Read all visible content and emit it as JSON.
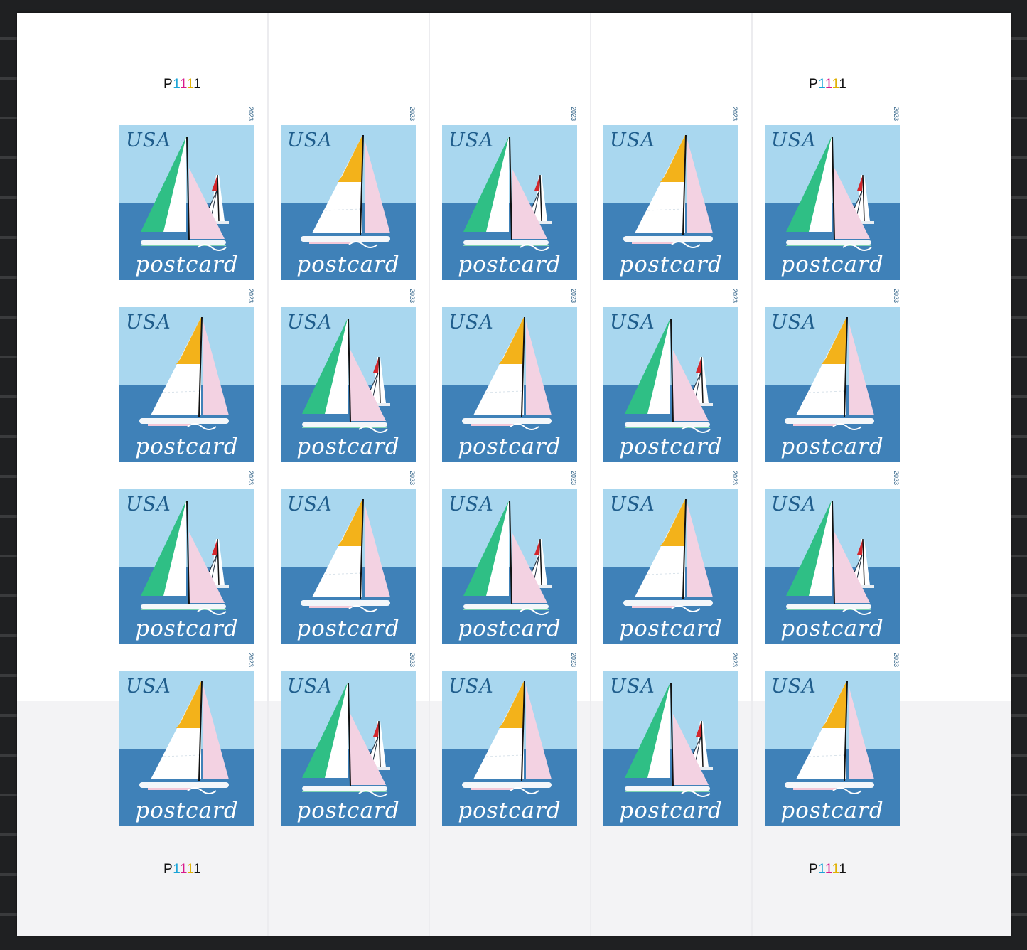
{
  "sheet": {
    "plate_number": "P1111",
    "plate_digit_colors": [
      "#111111",
      "#1aa3d6",
      "#d8198c",
      "#e0b000",
      "#111111"
    ]
  },
  "stamp": {
    "country": "USA",
    "denomination": "postcard",
    "year": "2023",
    "colors": {
      "sky": "#a9d7ef",
      "sea": "#3f81b8",
      "green_sail": "#2fbf85",
      "yellow_sail": "#f3b21a",
      "pink_sail": "#f3d2e2",
      "red_flag": "#d3262c"
    }
  },
  "grid": {
    "rows": [
      [
        "green",
        "yellow",
        "green",
        "yellow",
        "green"
      ],
      [
        "yellow",
        "green",
        "yellow",
        "green",
        "yellow"
      ],
      [
        "green",
        "yellow",
        "green",
        "yellow",
        "green"
      ],
      [
        "yellow",
        "green",
        "yellow",
        "green",
        "yellow"
      ]
    ]
  }
}
